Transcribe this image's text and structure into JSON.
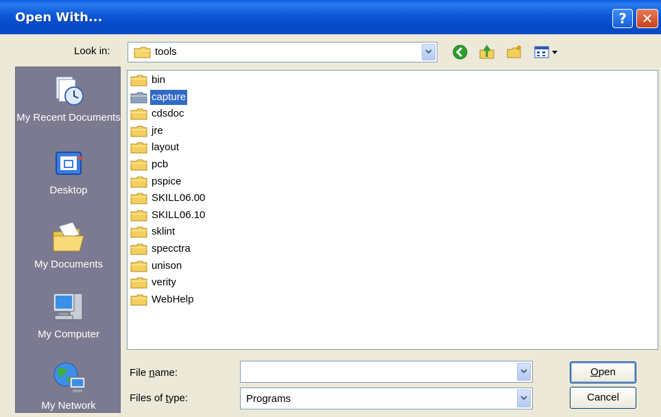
{
  "window": {
    "title": "Open With...",
    "help_glyph": "?",
    "close_glyph": "✕"
  },
  "lookin": {
    "label": "Look in:",
    "value": "tools"
  },
  "toolbar": {
    "icons": [
      "back-icon",
      "up-folder-icon",
      "new-folder-icon",
      "views-menu-icon"
    ]
  },
  "places": [
    {
      "label": "My Recent Documents",
      "icon": "recent-documents-icon"
    },
    {
      "label": "Desktop",
      "icon": "desktop-icon"
    },
    {
      "label": "My Documents",
      "icon": "my-documents-icon"
    },
    {
      "label": "My Computer",
      "icon": "my-computer-icon"
    },
    {
      "label": "My Network",
      "icon": "my-network-icon"
    }
  ],
  "folders": [
    {
      "name": "bin"
    },
    {
      "name": "capture",
      "selected": true
    },
    {
      "name": "cdsdoc"
    },
    {
      "name": "jre"
    },
    {
      "name": "layout"
    },
    {
      "name": "pcb"
    },
    {
      "name": "pspice"
    },
    {
      "name": "SKILL06.00"
    },
    {
      "name": "SKILL06.10"
    },
    {
      "name": "sklint"
    },
    {
      "name": "specctra"
    },
    {
      "name": "unison"
    },
    {
      "name": "verity"
    },
    {
      "name": "WebHelp"
    }
  ],
  "filename": {
    "label_pre": "File ",
    "label_u": "n",
    "label_post": "ame:",
    "value": ""
  },
  "filetype": {
    "label_pre": "Files of ",
    "label_u": "t",
    "label_post": "ype:",
    "value": "Programs"
  },
  "buttons": {
    "open_u": "O",
    "open_rest": "pen",
    "cancel": "Cancel"
  },
  "colors": {
    "title_bar": "#0b57d6",
    "selection": "#316ac5",
    "places_bar": "#7b7a90",
    "folder": "#f4cf5e"
  }
}
